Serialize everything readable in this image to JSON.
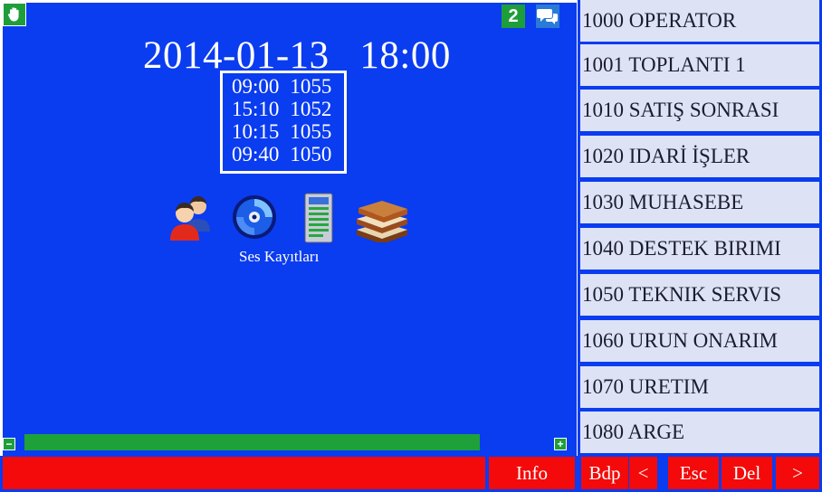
{
  "header": {
    "missed_count": "2",
    "datetime": "2014-01-13   18:00"
  },
  "call_log": [
    {
      "time": "09:00",
      "ext": "1055"
    },
    {
      "time": "15:10",
      "ext": "1052"
    },
    {
      "time": "10:15",
      "ext": "1055"
    },
    {
      "time": "09:40",
      "ext": "1050"
    }
  ],
  "apps": {
    "contacts_icon": "users-icon",
    "recordings_icon": "disc-icon",
    "recordings_label": "Ses Kayıtları",
    "document_icon": "document-icon",
    "book_icon": "books-icon"
  },
  "volume": {
    "level": 0.79,
    "minus_label": "−",
    "plus_label": "+"
  },
  "contacts": [
    "1000 OPERATOR",
    "1001 TOPLANTI  1",
    "1010 SATIŞ SONRASI",
    "1020 IDARİ İŞLER",
    "1030 MUHASEBE",
    "1040 DESTEK BIRIMI",
    "1050 TEKNIK SERVIS",
    "1060 URUN ONARIM",
    "1070 URETIM",
    "1080 ARGE"
  ],
  "buttons": {
    "info": "Info",
    "bdp": "Bdp",
    "back": "<",
    "esc": "Esc",
    "del": "Del",
    "next": ">"
  },
  "colors": {
    "background": "#0a3cf0",
    "accent_green": "#1fa13a",
    "button_red": "#f40a0a",
    "contact_bg": "#dde3f4"
  }
}
